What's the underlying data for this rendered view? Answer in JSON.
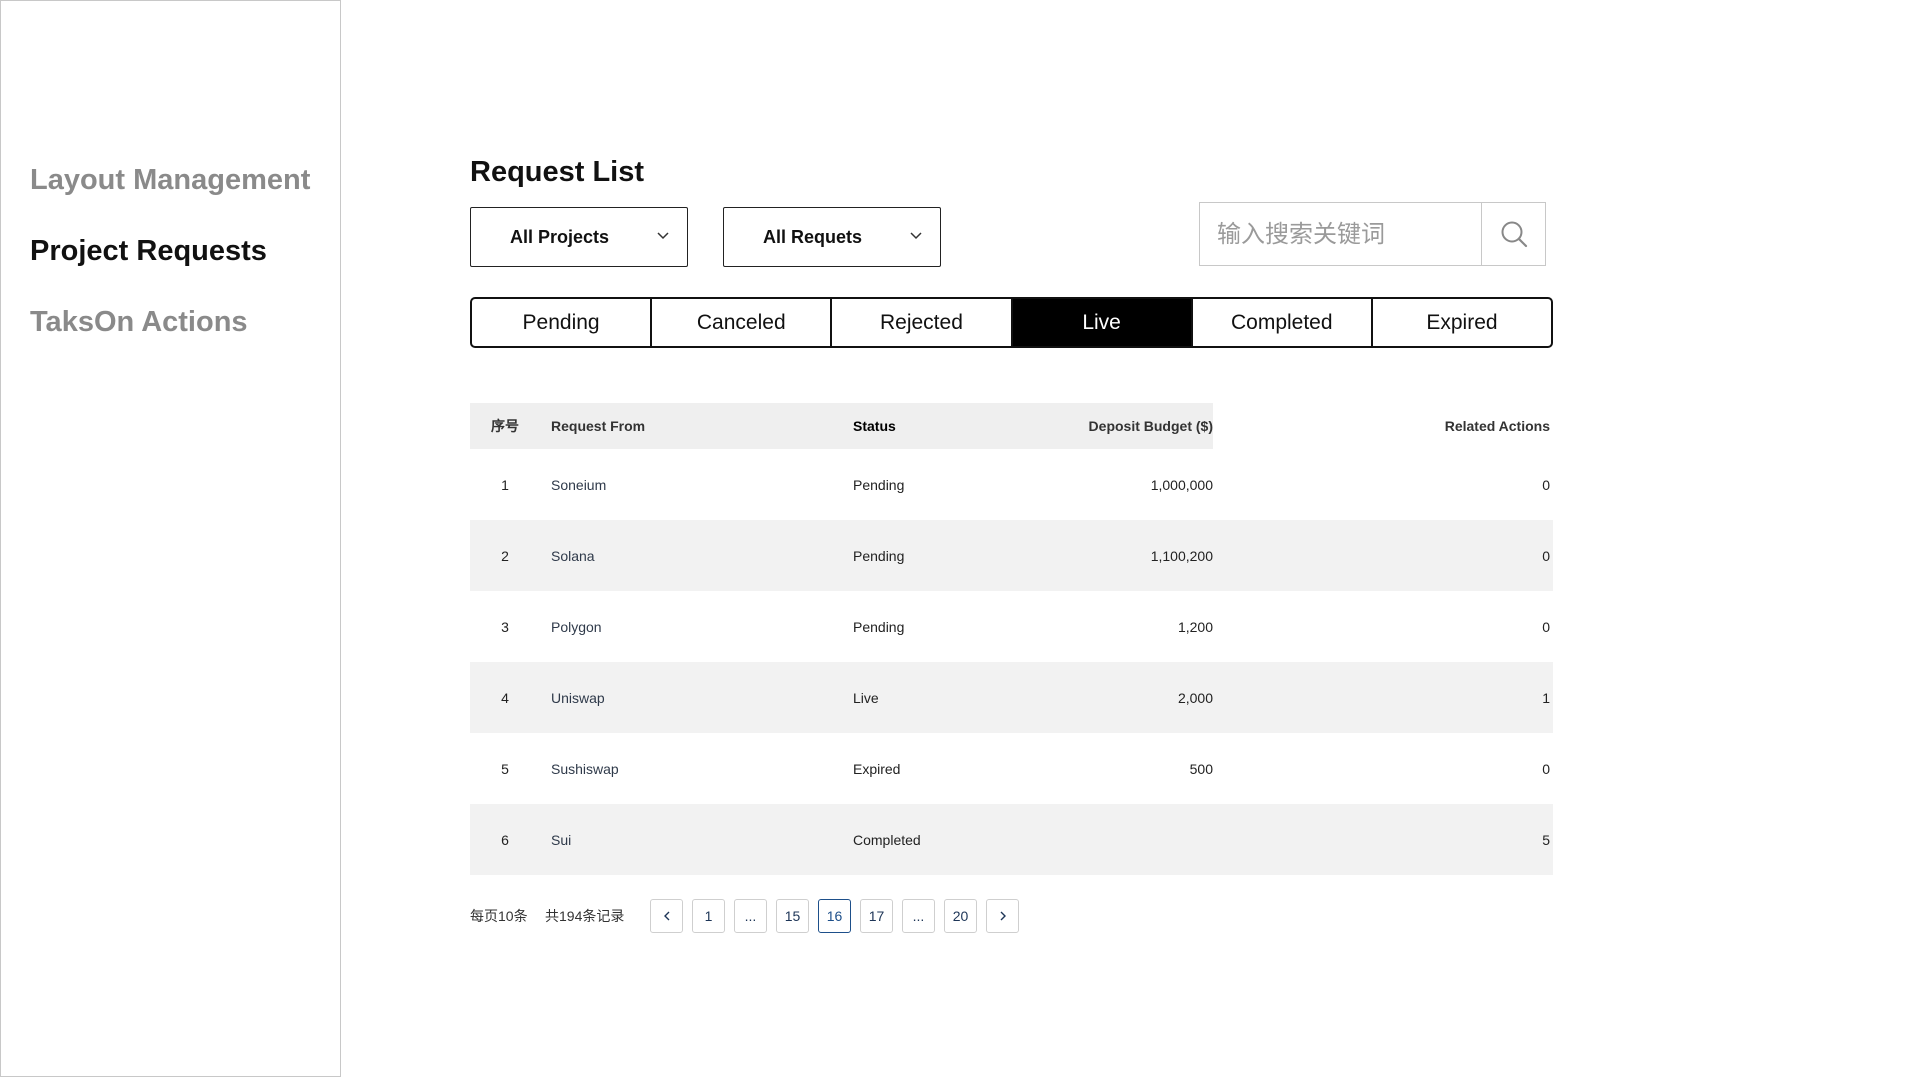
{
  "sidebar": {
    "items": [
      {
        "label": "Layout Management",
        "active": false
      },
      {
        "label": "Project Requests",
        "active": true
      },
      {
        "label": "TaksOn Actions",
        "active": false
      }
    ]
  },
  "main": {
    "title": "Request List",
    "filters": {
      "projects": "All Projects",
      "requests": "All Requets"
    },
    "search": {
      "placeholder": "输入搜索关键词",
      "value": ""
    },
    "tabs": [
      {
        "label": "Pending",
        "active": false
      },
      {
        "label": "Canceled",
        "active": false
      },
      {
        "label": "Rejected",
        "active": false
      },
      {
        "label": "Live",
        "active": true
      },
      {
        "label": "Completed",
        "active": false
      },
      {
        "label": "Expired",
        "active": false
      }
    ],
    "table": {
      "headers": {
        "index": "序号",
        "from": "Request From",
        "status": "Status",
        "budget": "Deposit Budget ($)",
        "actions": "Related Actions"
      },
      "rows": [
        {
          "index": "1",
          "from": "Soneium",
          "status": "Pending",
          "budget": "1,000,000",
          "actions": "0"
        },
        {
          "index": "2",
          "from": "Solana",
          "status": "Pending",
          "budget": "1,100,200",
          "actions": "0"
        },
        {
          "index": "3",
          "from": "Polygon",
          "status": "Pending",
          "budget": "1,200",
          "actions": "0"
        },
        {
          "index": "4",
          "from": "Uniswap",
          "status": "Live",
          "budget": "2,000",
          "actions": "1"
        },
        {
          "index": "5",
          "from": "Sushiswap",
          "status": "Expired",
          "budget": "500",
          "actions": "0"
        },
        {
          "index": "6",
          "from": "Sui",
          "status": "Completed",
          "budget": "",
          "actions": "5"
        }
      ]
    },
    "pagination": {
      "per_page": "每页10条",
      "total": "共194条记录",
      "prev_icon": "chevron-left-icon",
      "next_icon": "chevron-right-icon",
      "pages": [
        "1",
        "...",
        "15",
        "16",
        "17",
        "...",
        "20"
      ],
      "current": "16"
    }
  },
  "colors": {
    "active_tab_bg": "#000000",
    "row_alt_bg": "#f2f2f2",
    "page_active": "#1d4f8a"
  }
}
